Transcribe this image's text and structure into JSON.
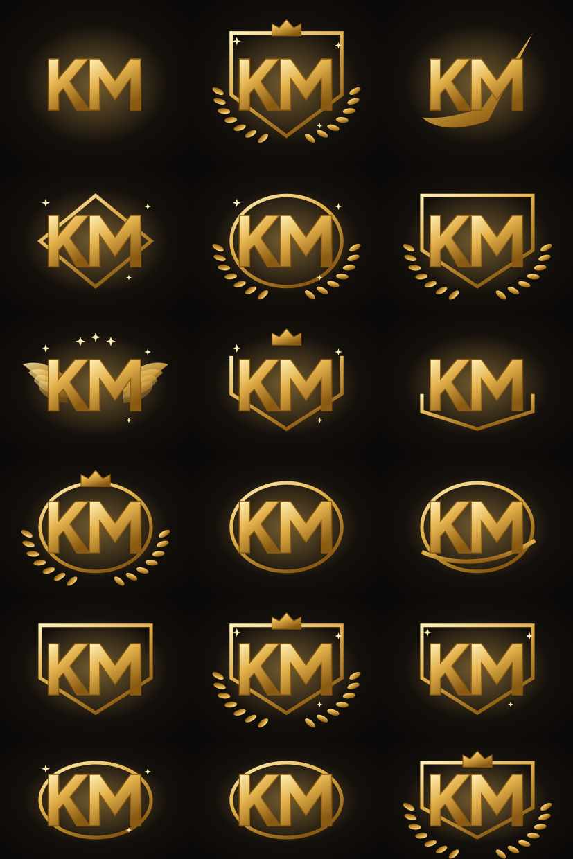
{
  "colors": {
    "background": "#0b0908",
    "gold_light": "#fff0b8",
    "gold_mid": "#e2b04a",
    "gold_dark": "#8a5a12",
    "glow": "#f3c55a"
  },
  "logos": [
    {
      "monogram": "KM",
      "style": "stripe-letters",
      "accents": []
    },
    {
      "monogram": "KM",
      "style": "shield",
      "accents": [
        "crown",
        "laurel",
        "sparkles"
      ]
    },
    {
      "monogram": "KM",
      "style": "sweep",
      "accents": [
        "swoosh"
      ]
    },
    {
      "monogram": "KM",
      "style": "diamond",
      "accents": [
        "sparkles"
      ]
    },
    {
      "monogram": "KM",
      "style": "arch",
      "accents": [
        "laurel",
        "star"
      ]
    },
    {
      "monogram": "KM",
      "style": "shield",
      "accents": [
        "laurel"
      ]
    },
    {
      "monogram": "KM",
      "style": "winged",
      "accents": [
        "wings",
        "stars"
      ]
    },
    {
      "monogram": "KM",
      "style": "crest",
      "accents": [
        "crown",
        "sparkles"
      ]
    },
    {
      "monogram": "KM",
      "style": "hex-base",
      "accents": []
    },
    {
      "monogram": "KM",
      "style": "wreath",
      "accents": [
        "crown",
        "laurel"
      ]
    },
    {
      "monogram": "KM",
      "style": "oval-ring",
      "accents": []
    },
    {
      "monogram": "KM",
      "style": "oval-ring",
      "accents": [
        "swoosh"
      ]
    },
    {
      "monogram": "KM",
      "style": "shield",
      "accents": []
    },
    {
      "monogram": "KM",
      "style": "shield",
      "accents": [
        "crown",
        "laurel",
        "sparkles"
      ]
    },
    {
      "monogram": "KM",
      "style": "shield",
      "accents": [
        "sparkles"
      ]
    },
    {
      "monogram": "KM",
      "style": "ring",
      "accents": [
        "sparkles"
      ]
    },
    {
      "monogram": "KM",
      "style": "oval-ring",
      "accents": []
    },
    {
      "monogram": "KM",
      "style": "shield",
      "accents": [
        "crown",
        "laurel"
      ]
    }
  ]
}
